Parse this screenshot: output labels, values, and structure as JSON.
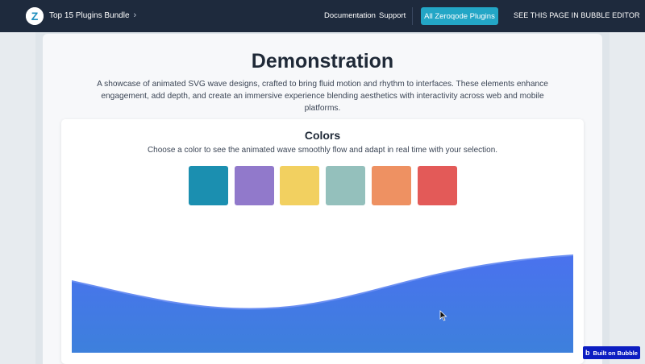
{
  "nav": {
    "brand_label": "Top 15 Plugins Bundle",
    "brand_chevron": "›",
    "logo_letter": "Z",
    "documentation": "Documentation",
    "support": "Support",
    "all_plugins": "All Zeroqode Plugins",
    "editor": "SEE THIS PAGE IN BUBBLE EDITOR"
  },
  "page": {
    "title": "Demonstration",
    "description": "A showcase of animated SVG wave designs, crafted to bring fluid motion and rhythm to interfaces. These elements enhance engagement, add depth, and create an immersive experience blending aesthetics with interactivity across web and mobile platforms."
  },
  "colors_section": {
    "title": "Colors",
    "description": "Choose a color to see the animated wave smoothly flow and adapt in real time with your selection.",
    "swatches": [
      "#1b8fb0",
      "#9179cb",
      "#f2d060",
      "#94c0bc",
      "#ee9162",
      "#e35a58"
    ]
  },
  "wave": {
    "gradient_top": "#4a72ee",
    "gradient_bottom": "#3d80dc",
    "crest_color": "#6a8ef2"
  },
  "badge": {
    "icon": "b",
    "label": "Built on Bubble"
  }
}
